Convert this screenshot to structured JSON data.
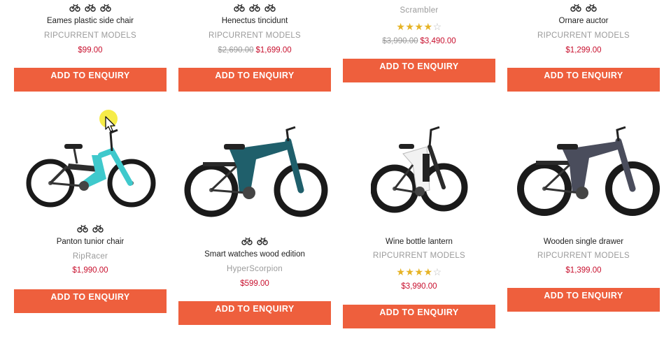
{
  "button_label": "ADD TO ENQUIRY",
  "colors": {
    "button": "#ee5f3d",
    "price": "#c8102e",
    "star": "#e6b325"
  },
  "products": [
    {
      "name": "Eames plastic side chair",
      "brand": "RIPCURRENT MODELS",
      "price": "$99.00",
      "old_price": "",
      "bike_icons": 3,
      "rating": 0
    },
    {
      "name": "Henectus tincidunt",
      "brand": "RIPCURRENT MODELS",
      "price": "$1,699.00",
      "old_price": "$2,690.00",
      "bike_icons": 3,
      "rating": 0
    },
    {
      "name": "",
      "brand": "Scrambler",
      "price": "$3,490.00",
      "old_price": "$3,990.00",
      "bike_icons": 0,
      "rating": 4
    },
    {
      "name": "Ornare auctor",
      "brand": "RIPCURRENT MODELS",
      "price": "$1,299.00",
      "old_price": "",
      "bike_icons": 2,
      "rating": 0
    },
    {
      "name": "Panton tunior chair",
      "brand": "RipRacer",
      "price": "$1,990.00",
      "old_price": "",
      "bike_icons": 2,
      "rating": 0,
      "bike_color": "#3fc9cc"
    },
    {
      "name": "Smart watches wood edition",
      "brand": "HyperScorpion",
      "price": "$599.00",
      "old_price": "",
      "bike_icons": 2,
      "rating": 0,
      "bike_color": "#1f5f6b"
    },
    {
      "name": "Wine bottle lantern",
      "brand": "RIPCURRENT MODELS",
      "price": "$3,990.00",
      "old_price": "",
      "bike_icons": 0,
      "rating": 4,
      "bike_color": "#f2f2f2"
    },
    {
      "name": "Wooden single drawer",
      "brand": "RIPCURRENT MODELS",
      "price": "$1,399.00",
      "old_price": "",
      "bike_icons": 0,
      "rating": 0,
      "bike_color": "#4a4d5c"
    }
  ]
}
